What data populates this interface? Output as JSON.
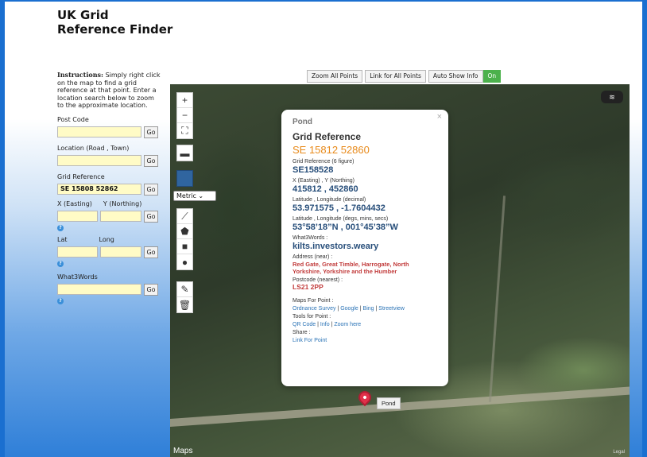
{
  "app": {
    "title_line1": "UK Grid",
    "title_line2": "Reference Finder"
  },
  "sidebar": {
    "instructions_bold": "Instructions:",
    "instructions_text": "Simply right click on the map to find a grid reference at that point. Enter a location search below to zoom to the approximate location.",
    "postcode_label": "Post Code",
    "postcode_value": "",
    "location_label": "Location (Road , Town)",
    "location_value": "",
    "gridref_label": "Grid Reference",
    "gridref_value": "SE 15808 52862",
    "easting_label": "X (Easting)",
    "northing_label": "Y (Northing)",
    "lat_label": "Lat",
    "long_label": "Long",
    "what3words_label": "What3Words",
    "go_label": "Go",
    "help_glyph": "?"
  },
  "toolbar": {
    "zoom_all": "Zoom All Points",
    "link_all": "Link for All Points",
    "auto_show": "Auto Show Info",
    "auto_show_state": "On"
  },
  "map_controls": {
    "zoom_in": "+",
    "zoom_out": "−",
    "fullscreen": "⛶",
    "folder": "▬",
    "units": "Metric",
    "line": "⟋",
    "polygon": "⬟",
    "square": "■",
    "circle": "●",
    "edit": "✎",
    "delete": "🗑",
    "layers": "≋"
  },
  "popup": {
    "close": "×",
    "name": "Pond",
    "heading": "Grid Reference",
    "grid_ref": "SE 15812 52860",
    "six_fig_label": "Grid Reference (6 figure)",
    "six_fig_value": "SE158528",
    "xy_label": "X (Easting) , Y (Northing)",
    "xy_value": "415812 , 452860",
    "latlon_dec_label": "Latitude , Longitude (decimal)",
    "latlon_dec_value": "53.971575 , -1.7604432",
    "latlon_dms_label": "Latitude , Longitude (degs, mins, secs)",
    "latlon_dms_value": "53°58’18”N , 001°45’38”W",
    "w3w_label": "What3Words :",
    "w3w_value": "kilts.investors.weary",
    "address_label": "Address (near) :",
    "address_value": "Red Gate, Great Timble, Harrogate, North Yorkshire, Yorkshire and the Humber",
    "postcode_label": "Postcode (nearest) :",
    "postcode_value": "LS21 2PP",
    "maps_label": "Maps For Point :",
    "map_os": "Ordnance Survey",
    "map_google": "Google",
    "map_bing": "Bing",
    "map_streetview": "Streetview",
    "sep": "|",
    "tools_label": "Tools for Point :",
    "tool_qr": "QR Code",
    "tool_info": "Info",
    "tool_zoom": "Zoom here",
    "share_label": "Share :",
    "share_link": "Link For Point"
  },
  "marker": {
    "label": "Pond"
  },
  "footer": {
    "apple_maps": " Maps",
    "legal": "Legal"
  }
}
